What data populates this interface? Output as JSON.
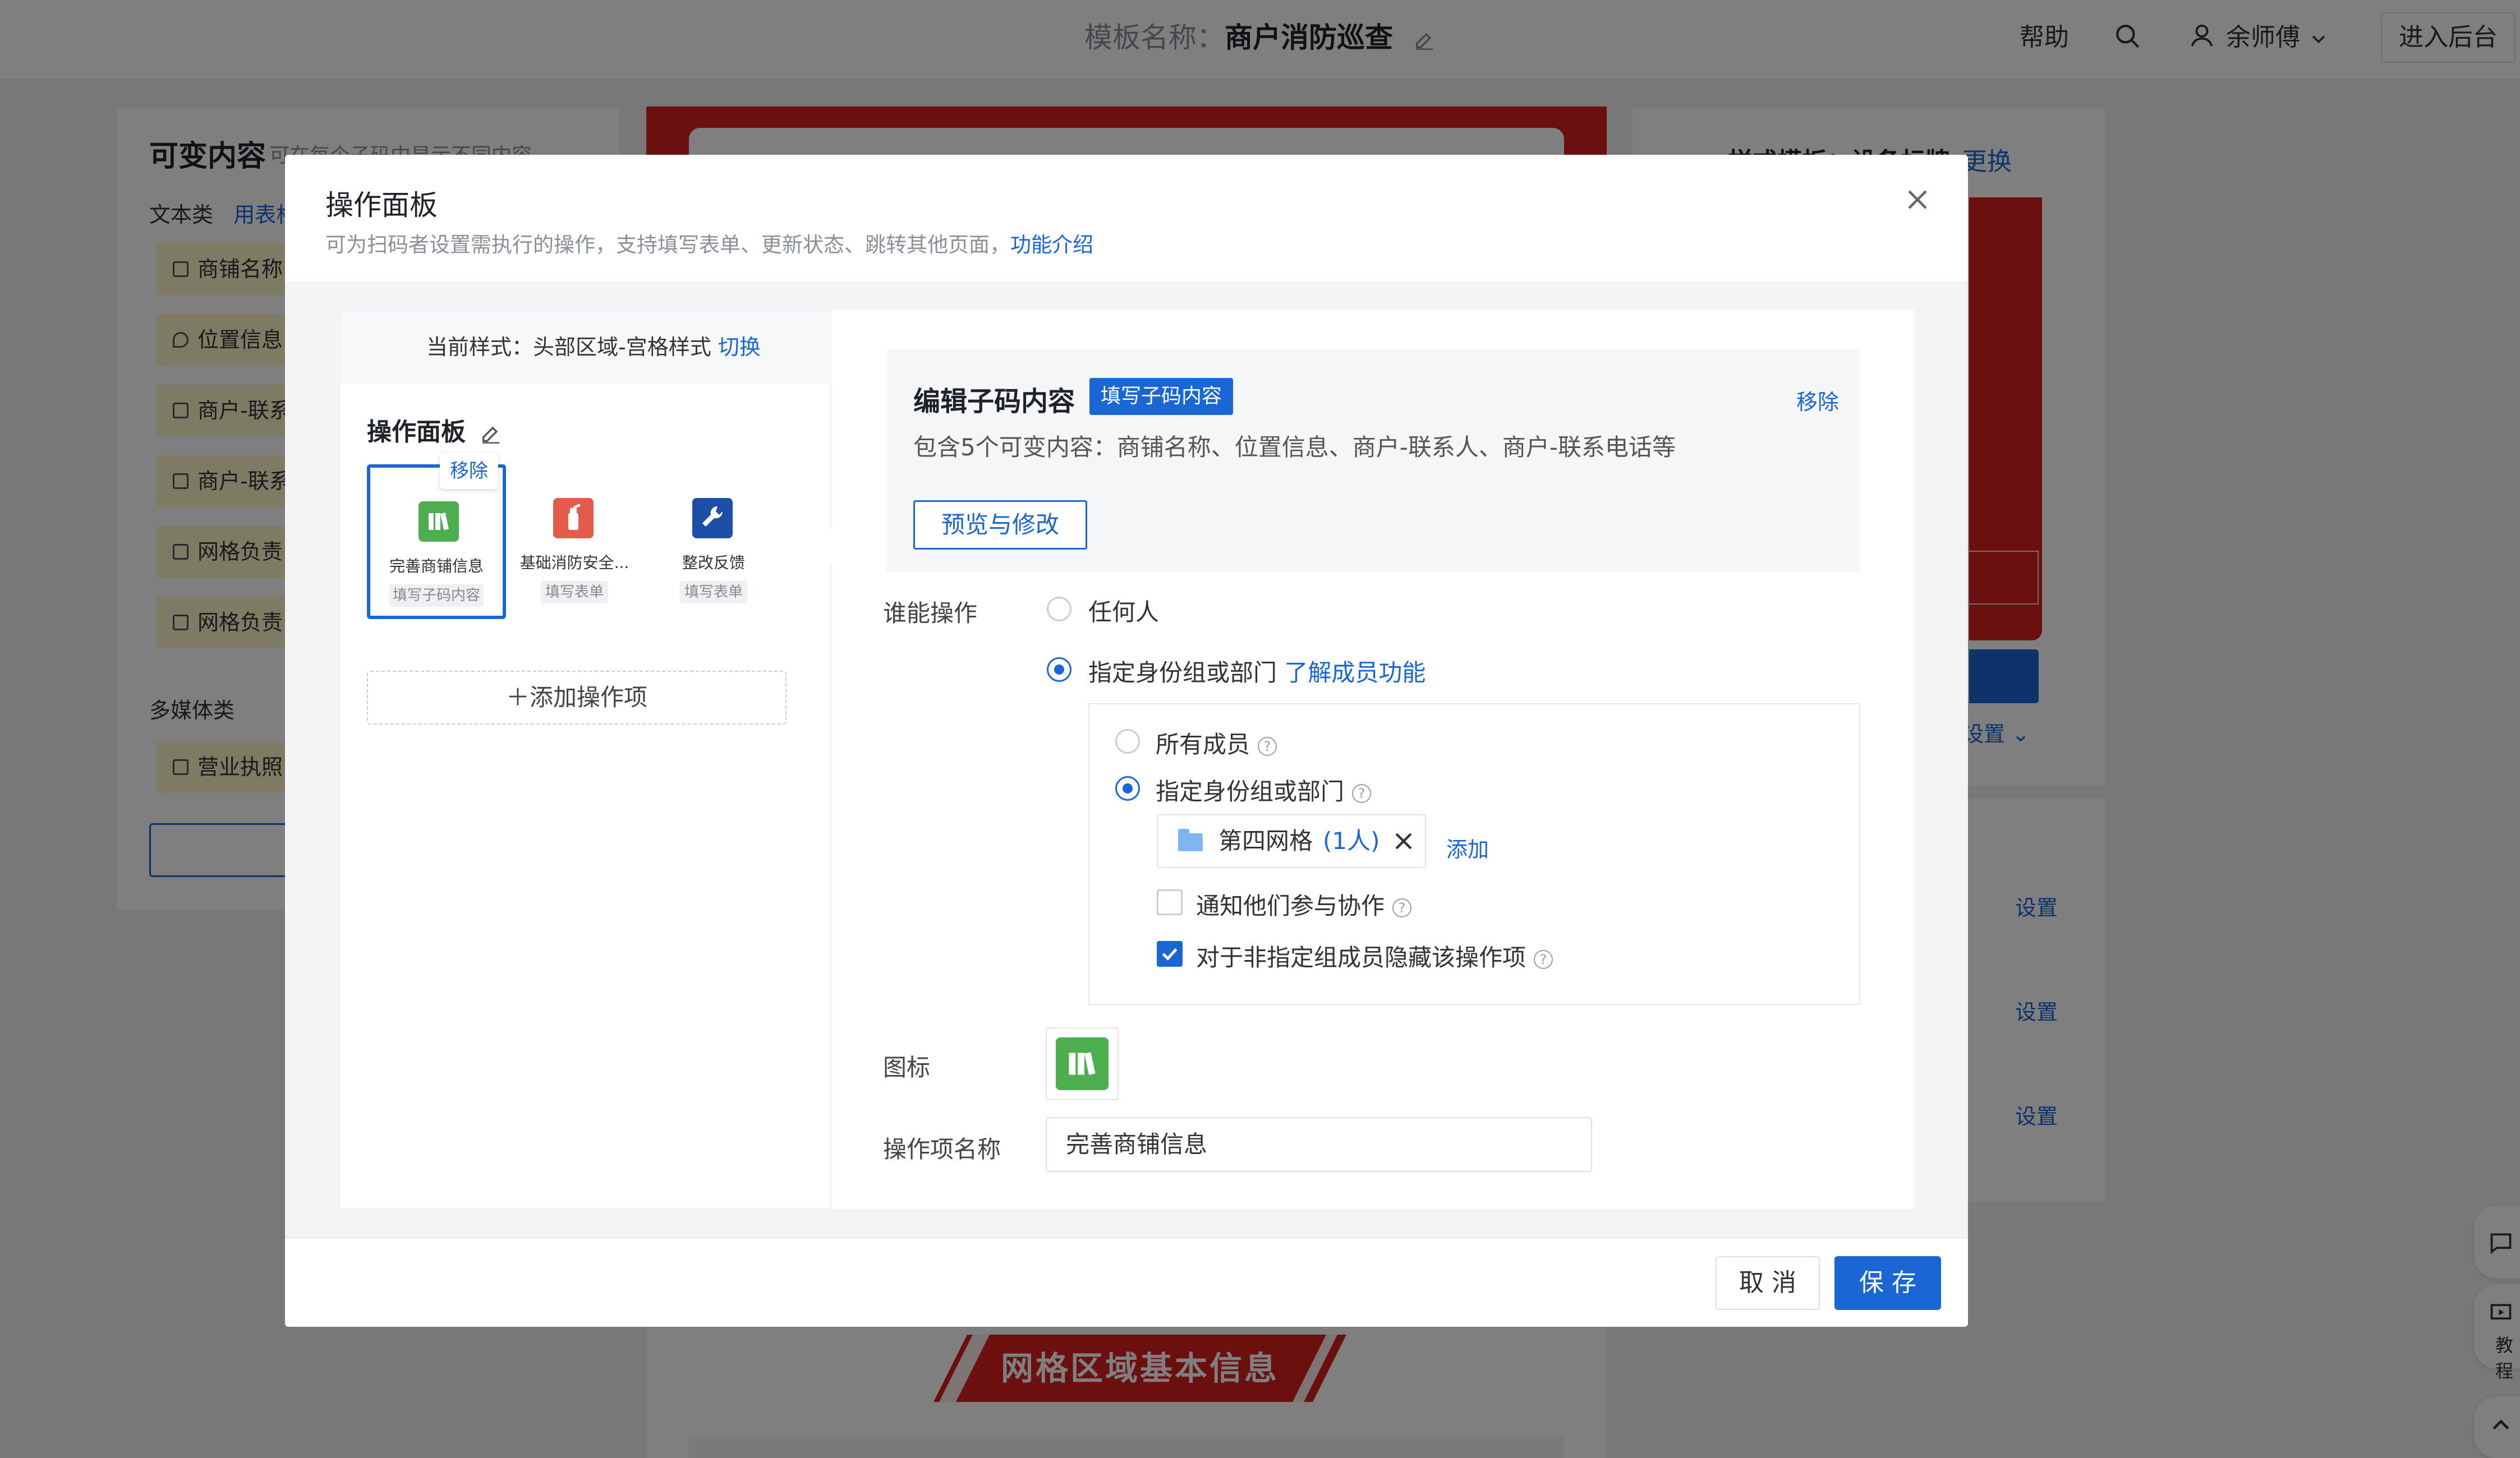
{
  "header": {
    "template_label": "模板名称：",
    "template_name": "商户消防巡查",
    "help": "帮助",
    "user_name": "余师傅",
    "enter_backend": "进入后台"
  },
  "left_panel": {
    "title": "可变内容",
    "subtitle": "可在每个子码中显示不同内容",
    "text_category": "文本类",
    "text_category_link": "用表格",
    "fields": [
      "商铺名称",
      "位置信息",
      "商户-联系",
      "商户-联系",
      "网格负责",
      "网格负责"
    ],
    "media_category": "多媒体类",
    "media_fields": [
      "营业执照"
    ]
  },
  "right_panel": {
    "style_title": "样式模板：设备标牌",
    "change_link": "更换",
    "settings_dropdown": "设置",
    "set_links": [
      "设置",
      "设置",
      "设置"
    ]
  },
  "center": {
    "banner_text": "网格区域基本信息"
  },
  "side_float": {
    "tutorial": "教程"
  },
  "modal": {
    "title": "操作面板",
    "subtitle": "可为扫码者设置需执行的操作，支持填写表单、更新状态、跳转其他页面，",
    "intro_link": "功能介绍",
    "current_style_label": "当前样式：头部区域-宫格样式",
    "switch_link": "切换",
    "panel_title": "操作面板",
    "remove_popup": "移除",
    "tiles": [
      {
        "label": "完善商铺信息",
        "tag": "填写子码内容",
        "color": "#4cae4f",
        "icon": "books-icon"
      },
      {
        "label": "基础消防安全...",
        "tag": "填写表单",
        "color": "#e25b4b",
        "icon": "fire-extinguisher-icon"
      },
      {
        "label": "整改反馈",
        "tag": "填写表单",
        "color": "#1d4fa8",
        "icon": "wrench-icon"
      }
    ],
    "add_op": "添加操作项",
    "edit": {
      "title": "编辑子码内容",
      "tag": "填写子码内容",
      "remove": "移除",
      "desc": "包含5个可变内容：商铺名称、位置信息、商户-联系人、商户-联系电话等",
      "preview_btn": "预览与修改"
    },
    "who_label": "谁能操作",
    "opt_anyone": "任何人",
    "opt_group": "指定身份组或部门",
    "member_link": "了解成员功能",
    "sub_all": "所有成员",
    "sub_group": "指定身份组或部门",
    "member_tag_name": "第四网格",
    "member_tag_count": "(1人)",
    "add": "添加",
    "notify": "通知他们参与协作",
    "hide": "对于非指定组成员隐藏该操作项",
    "icon_label": "图标",
    "name_label": "操作项名称",
    "name_value": "完善商铺信息",
    "cancel": "取 消",
    "save": "保 存"
  }
}
